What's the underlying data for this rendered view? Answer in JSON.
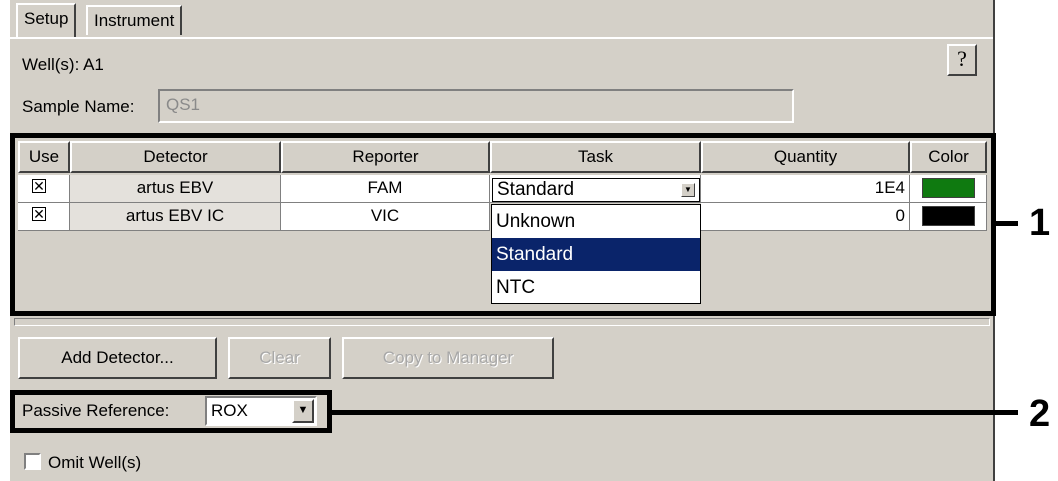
{
  "tabs": [
    {
      "label": "Setup",
      "active": true
    },
    {
      "label": "Instrument",
      "active": false
    }
  ],
  "wells": {
    "label": "Well(s): A1"
  },
  "help": {
    "label": "?"
  },
  "sample": {
    "label": "Sample Name:",
    "value": "QS1"
  },
  "table": {
    "headers": [
      "Use",
      "Detector",
      "Reporter",
      "Task",
      "Quantity",
      "Color"
    ],
    "rows": [
      {
        "use": "☒",
        "detector": "artus EBV",
        "reporter": "FAM",
        "task": "Standard",
        "quantity": "1E4",
        "color": "#0f7a10"
      },
      {
        "use": "☒",
        "detector": "artus EBV IC",
        "reporter": "VIC",
        "task": "",
        "quantity": "0",
        "color": "#000000"
      }
    ]
  },
  "task_dropdown": {
    "options": [
      "Unknown",
      "Standard",
      "NTC"
    ],
    "selected": "Standard"
  },
  "buttons": {
    "add_detector": "Add Detector...",
    "clear": "Clear",
    "copy_to_manager": "Copy to Manager"
  },
  "passive_reference": {
    "label": "Passive Reference:",
    "value": "ROX"
  },
  "omit": {
    "label": "Omit Well(s)"
  },
  "callouts": [
    "1",
    "2"
  ],
  "colors": {
    "selection": "#0a246a",
    "panel": "#d4d0c8"
  }
}
